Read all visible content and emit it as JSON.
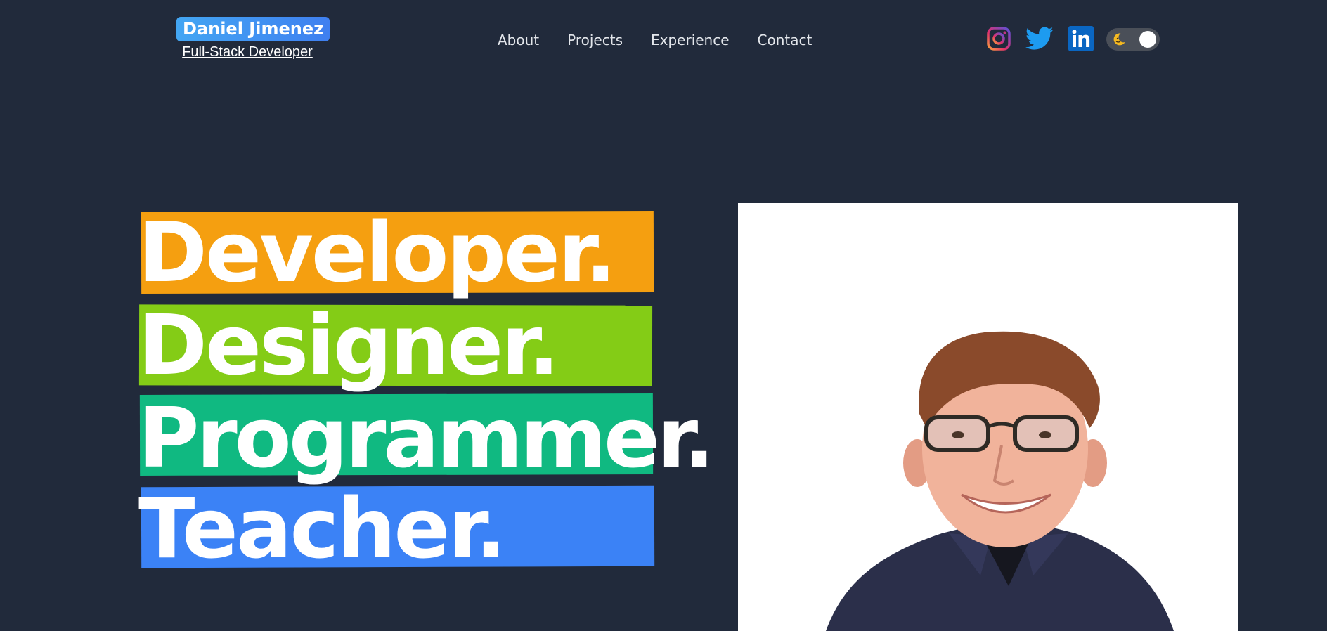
{
  "header": {
    "brand_name": "Daniel Jimenez",
    "brand_subtitle": "Full-Stack Developer",
    "nav": [
      {
        "label": "About"
      },
      {
        "label": "Projects"
      },
      {
        "label": "Experience"
      },
      {
        "label": "Contact"
      }
    ],
    "social_icons": [
      "instagram-icon",
      "twitter-icon",
      "linkedin-icon"
    ],
    "theme_toggle": {
      "icon": "moon-icon",
      "state": "dark"
    }
  },
  "hero": {
    "words": [
      "Developer.",
      "Designer.",
      "Programmer.",
      "Teacher."
    ],
    "band_colors": [
      "#f59f10",
      "#84cc16",
      "#10b981",
      "#3b82f6"
    ]
  },
  "colors": {
    "background": "#212a3b",
    "brand_gradient_start": "#43a6f3",
    "brand_gradient_end": "#3f7ff0"
  },
  "portrait": {
    "background": "#ffffff"
  }
}
